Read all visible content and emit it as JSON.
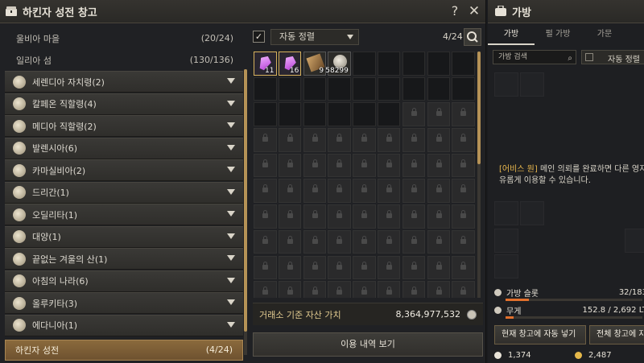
{
  "storage": {
    "title": "하킨자 성전 창고",
    "help_label": "?",
    "close_label": "✕",
    "plain_regions": [
      {
        "name": "울비아 마을",
        "count": "(20/24)"
      },
      {
        "name": "일리아 섬",
        "count": "(130/136)"
      }
    ],
    "regions": [
      {
        "label": "세렌디아 자치령(2)",
        "icon": "serendia-icon"
      },
      {
        "label": "칼페온 직할령(4)",
        "icon": "calpheon-icon"
      },
      {
        "label": "메디아 직할령(2)",
        "icon": "mediah-icon"
      },
      {
        "label": "발렌시아(6)",
        "icon": "valencia-icon"
      },
      {
        "label": "카마실비아(2)",
        "icon": "kamasylvia-icon"
      },
      {
        "label": "드리간(1)",
        "icon": "drieghan-icon"
      },
      {
        "label": "오딜리타(1)",
        "icon": "odyllita-icon"
      },
      {
        "label": "대양(1)",
        "icon": "ocean-icon"
      },
      {
        "label": "끝없는 겨울의 산(1)",
        "icon": "mountain-icon"
      },
      {
        "label": "아침의 나라(6)",
        "icon": "morning-land-icon"
      },
      {
        "label": "올루키타(3)",
        "icon": "olukita-icon"
      },
      {
        "label": "에다니아(1)",
        "icon": "edania-icon"
      }
    ],
    "selected_region": {
      "name": "하킨자 성전",
      "count": "(4/24)"
    },
    "auto_sort_label": "자동 정렬",
    "slot_count": "4/24",
    "items": [
      {
        "type": "gem",
        "qty": "11"
      },
      {
        "type": "gem",
        "qty": "16"
      },
      {
        "type": "scroll",
        "qty": "9"
      },
      {
        "type": "coin",
        "qty": "58299"
      }
    ],
    "asset_label": "거래소 기준 자산 가치",
    "asset_value": "8,364,977,532",
    "history_button": "이용 내역 보기"
  },
  "bag": {
    "title": "가방",
    "tabs": [
      "가방",
      "펄 가방",
      "가문"
    ],
    "search_placeholder": "가방 검색",
    "auto_sort_label": "자동 정렬",
    "message_highlight": "[어비스 원]",
    "message_rest": " 메인 의뢰를 완료하면 다른 영지",
    "message_line2": "유롭게 이용할 수 있습니다.",
    "slots_label": "가방 슬롯",
    "slots_value": "32/183",
    "slots_fill": 0.17,
    "weight_label": "무게",
    "weight_value": "152.8 / 2,692 LT",
    "weight_fill": 0.06,
    "btn_deposit_auto": "현재 창고에 자동 넣기",
    "btn_deposit_all": "전체 창고에 자",
    "currency_1": "1,374",
    "currency_2": "2,487"
  },
  "colors": {
    "accent_gold": "#b59256",
    "highlight": "#e8b74d",
    "weight_bar": "#e2702c"
  }
}
